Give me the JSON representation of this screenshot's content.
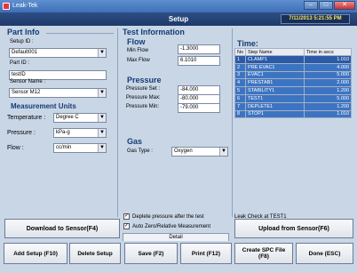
{
  "window": {
    "title": "Leak-Tek",
    "minimize": "–",
    "maximize": "□",
    "close": "✕"
  },
  "header": {
    "title": "Setup",
    "datetime": "7/11/2013 5:21:55 PM"
  },
  "part_info": {
    "heading": "Part Info",
    "setup_id_label": "Setup ID :",
    "setup_id_value": "Default001",
    "part_id_label": "Part ID :",
    "part_id_value": "testID",
    "sensor_name_label": "Sensor Name :",
    "sensor_name_value": "Sensor M12"
  },
  "units": {
    "heading": "Measurement Units",
    "temperature_label": "Temperature :",
    "temperature_value": "Degree C",
    "pressure_label": "Pressure :",
    "pressure_value": "kPa-g",
    "flow_label": "Flow :",
    "flow_value": "cc/min"
  },
  "test_info": {
    "heading": "Test Information",
    "flow_heading": "Flow",
    "min_flow_label": "Min Flow",
    "min_flow_value": "-1.3000",
    "max_flow_label": "Max Flow",
    "max_flow_value": "6.1010",
    "pressure_heading": "Pressure",
    "pressure_set_label": "Pressure Set :",
    "pressure_set_value": "-84.000",
    "pressure_max_label": "Pressure Max:",
    "pressure_max_value": "-80.000",
    "pressure_min_label": "Pressure Min:",
    "pressure_min_value": "-79.000",
    "gas_heading": "Gas",
    "gas_type_label": "Gas Type :",
    "gas_type_value": "Oxygen",
    "deplete_label": "Deplete pressure after the test",
    "autozero_label": "Auto Zero/Relative Measurement",
    "detail_label": "Detail"
  },
  "time": {
    "heading": "Time:",
    "columns": [
      "No",
      "Step Name",
      "Time in secs"
    ],
    "rows": [
      [
        "1",
        "CLAMP1",
        "1.010"
      ],
      [
        "2",
        "PRE EVAC1",
        "4.000"
      ],
      [
        "3",
        "EVAC1",
        "5.000"
      ],
      [
        "4",
        "PRESTAB1",
        "2.000"
      ],
      [
        "5",
        "STABILITY1",
        "1.200"
      ],
      [
        "6",
        "TEST1",
        "5.000"
      ],
      [
        "7",
        "DEPLETE1",
        "1.200"
      ],
      [
        "8",
        "STOP1",
        "1.010"
      ]
    ],
    "leak_check": "Leak Check at TEST1"
  },
  "buttons": {
    "download": "Download to Sensor(F4)",
    "upload": "Upload from Sensor(F6)",
    "add_setup": "Add Setup (F10)",
    "delete_setup": "Delete Setup",
    "save": "Save (F2)",
    "print": "Print (F12)",
    "spc_line1": "Create SPC File",
    "spc_line2": "(F8)",
    "done": "Done (ESC)"
  },
  "colors": {
    "header": "#1f3a68",
    "row_fill": "#3d74c2",
    "datetime_text": "#f7e56a"
  }
}
